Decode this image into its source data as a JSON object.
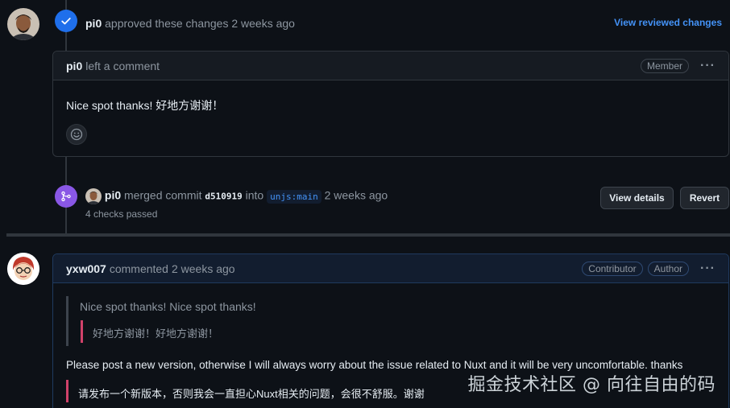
{
  "review": {
    "user": "pi0",
    "action": "approved these changes",
    "time": "2 weeks ago",
    "view_link": "View reviewed changes"
  },
  "comment1": {
    "user": "pi0",
    "action": "left a comment",
    "role": "Member",
    "body": "Nice spot thanks! 好地方谢谢！"
  },
  "merge": {
    "user": "pi0",
    "action": "merged commit",
    "sha": "d510919",
    "into": "into",
    "branch": "unjs:main",
    "time": "2 weeks ago",
    "checks": "4 checks passed",
    "view_details": "View details",
    "revert": "Revert"
  },
  "comment2": {
    "user": "yxw007",
    "action": "commented",
    "time": "2 weeks ago",
    "role1": "Contributor",
    "role2": "Author",
    "quote_en": "Nice spot thanks! Nice spot thanks!",
    "quote_zh": "好地方谢谢！好地方谢谢！",
    "body": "Please post a new version, otherwise I will always worry about the issue related to Nuxt and it will be very uncomfortable. thanks",
    "body_zh": "请发布一个新版本，否则我会一直担心Nuxt相关的问题，会很不舒服。谢谢"
  },
  "watermark": "掘金技术社区 @ 向往自由的码",
  "colors": {
    "background": "#0d1117",
    "approve": "#1f6feb",
    "merged": "#8957e5",
    "link": "#4493f8",
    "quote_accent": "#d1426a"
  },
  "icons": [
    "check-icon",
    "merge-icon",
    "smiley-icon",
    "kebab-icon"
  ]
}
